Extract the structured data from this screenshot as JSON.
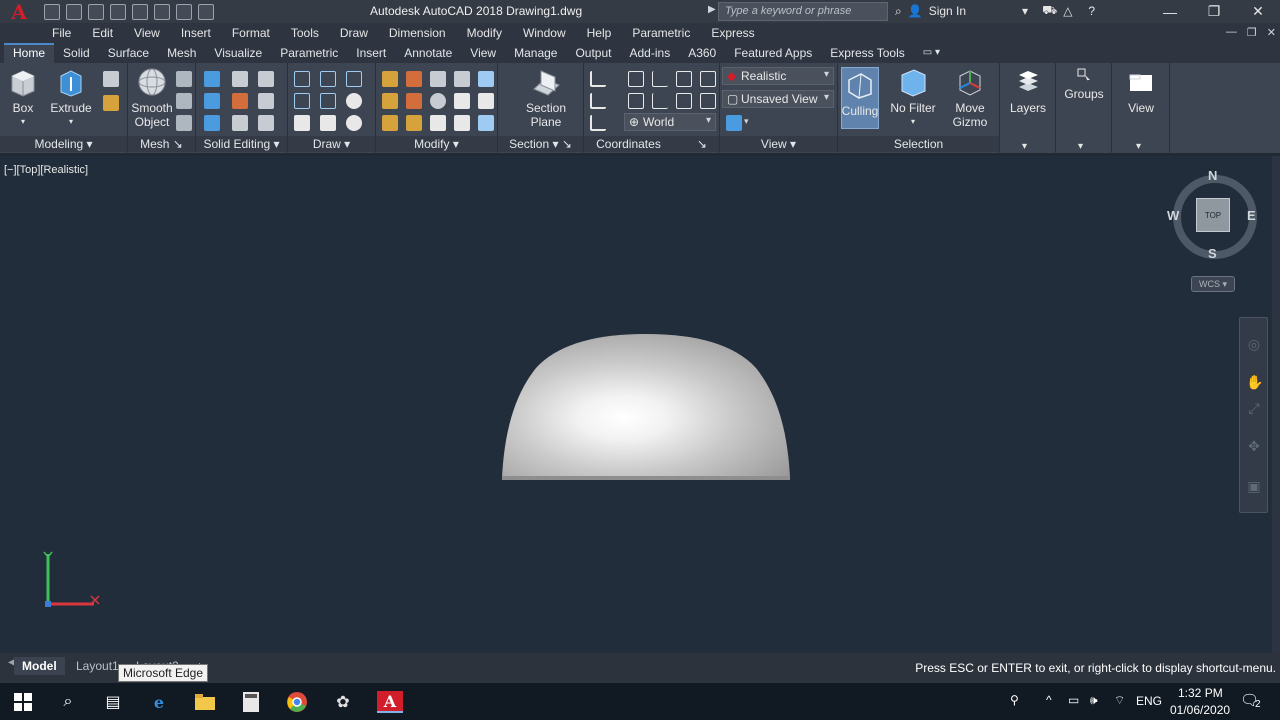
{
  "title_bar": {
    "app_logo": "A",
    "title": "Autodesk AutoCAD 2018   Drawing1.dwg",
    "search_placeholder": "Type a keyword or phrase",
    "sign_in": "Sign In"
  },
  "menu": [
    "File",
    "Edit",
    "View",
    "Insert",
    "Format",
    "Tools",
    "Draw",
    "Dimension",
    "Modify",
    "Window",
    "Help",
    "Parametric",
    "Express"
  ],
  "ribbon_tabs": [
    "Home",
    "Solid",
    "Surface",
    "Mesh",
    "Visualize",
    "Parametric",
    "Insert",
    "Annotate",
    "View",
    "Manage",
    "Output",
    "Add-ins",
    "A360",
    "Featured Apps",
    "Express Tools"
  ],
  "ribbon": {
    "buttons": {
      "box": "Box",
      "extrude": "Extrude",
      "smooth_object_1": "Smooth",
      "smooth_object_2": "Object",
      "section_plane_1": "Section",
      "section_plane_2": "Plane",
      "culling": "Culling",
      "no_filter": "No Filter",
      "move_gizmo_1": "Move",
      "move_gizmo_2": "Gizmo",
      "layers": "Layers",
      "groups": "Groups",
      "view": "View"
    },
    "combos": {
      "visual_style": "Realistic",
      "named_view": "Unsaved View",
      "ucs": "World"
    },
    "panels": {
      "modeling": "Modeling",
      "mesh": "Mesh",
      "solid_editing": "Solid Editing",
      "draw": "Draw",
      "modify": "Modify",
      "section": "Section",
      "coordinates": "Coordinates",
      "view": "View",
      "selection": "Selection"
    }
  },
  "viewport": {
    "label": "[−][Top][Realistic]",
    "viewcube": {
      "n": "N",
      "s": "S",
      "e": "E",
      "w": "W",
      "face": "TOP",
      "wcs": "WCS"
    }
  },
  "layout_tabs": [
    "Model",
    "Layout1",
    "Layout2"
  ],
  "tooltip": "Microsoft Edge",
  "command_line": "Press ESC or ENTER to exit, or right-click to display shortcut-menu.",
  "taskbar": {
    "language": "ENG",
    "time": "1:32 PM",
    "date": "01/06/2020",
    "notification_count": "2"
  },
  "colors": {
    "titlebar": "#353b45",
    "ribbon": "#3e4552",
    "viewport": "#212d3a",
    "accent": "#4c89c8",
    "autocad_red": "#d21e2b"
  }
}
